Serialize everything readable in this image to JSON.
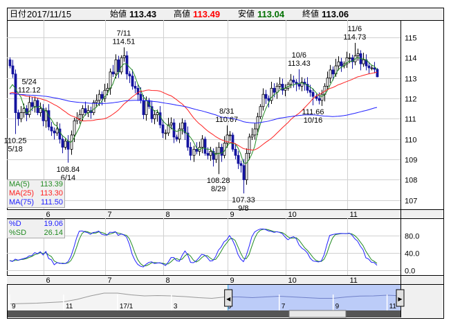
{
  "header": {
    "date_label": "日付",
    "date_value": "2017/11/15",
    "open_label": "始値",
    "open_value": "113.43",
    "high_label": "高値",
    "high_value": "113.49",
    "low_label": "安値",
    "low_value": "113.04",
    "close_label": "終値",
    "close_value": "113.06"
  },
  "colors": {
    "up": "#ffffff",
    "down": "#1414a0",
    "ma5": "#228b22",
    "ma25": "#ff2020",
    "ma75": "#2020ff",
    "d": "#2020ff",
    "sd": "#228b22",
    "high_text": "#ff0000",
    "low_text": "#007000",
    "nav_fill": "#bcccf8"
  },
  "ma_legend": [
    {
      "label": "MA(5)",
      "value": "113.39"
    },
    {
      "label": "MA(25)",
      "value": "113.30"
    },
    {
      "label": "MA(75)",
      "value": "111.50"
    }
  ],
  "stoch_legend": [
    {
      "label": "%D",
      "value": "19.06"
    },
    {
      "label": "%SD",
      "value": "26.14"
    }
  ],
  "chart_data": {
    "type": "candlestick",
    "price": {
      "ylim": [
        106.55,
        115.85
      ],
      "y_ticks": [
        "107",
        "108",
        "109",
        "110",
        "111",
        "112",
        "113",
        "114",
        "115"
      ],
      "month_labels": [
        {
          "label": "6",
          "start_index": 13
        },
        {
          "label": "7",
          "start_index": 35
        },
        {
          "label": "8",
          "start_index": 56
        },
        {
          "label": "9",
          "start_index": 79
        },
        {
          "label": "10",
          "start_index": 100
        },
        {
          "label": "11",
          "start_index": 122
        }
      ],
      "first_open": 113.9,
      "closes": [
        113.6,
        113.2,
        111.3,
        111.0,
        111.3,
        111.5,
        111.2,
        111.8,
        111.6,
        111.9,
        111.3,
        111.5,
        110.9,
        111.4,
        110.6,
        110.4,
        110.3,
        110.5,
        110.0,
        109.6,
        109.9,
        109.5,
        110.2,
        110.9,
        111.0,
        111.2,
        111.5,
        111.3,
        111.4,
        111.3,
        111.8,
        111.9,
        112.2,
        112.0,
        112.4,
        112.5,
        113.3,
        113.2,
        113.9,
        113.3,
        114.0,
        114.1,
        113.2,
        113.1,
        112.6,
        112.5,
        112.2,
        111.9,
        111.2,
        111.9,
        111.6,
        111.0,
        111.2,
        111.3,
        110.7,
        110.3,
        110.3,
        110.7,
        110.8,
        110.1,
        110.0,
        110.5,
        110.8,
        110.3,
        109.6,
        109.2,
        109.5,
        109.4,
        109.6,
        110.0,
        109.3,
        109.2,
        109.4,
        109.0,
        109.3,
        109.6,
        109.2,
        109.8,
        110.2,
        110.2,
        109.5,
        109.2,
        108.8,
        108.7,
        108.0,
        109.3,
        110.1,
        110.2,
        110.5,
        111.1,
        111.6,
        112.2,
        112.0,
        111.9,
        112.5,
        112.3,
        112.6,
        112.7,
        112.4,
        112.5,
        112.7,
        112.9,
        112.8,
        112.7,
        112.6,
        112.8,
        112.7,
        112.4,
        112.3,
        112.1,
        112.0,
        111.9,
        112.2,
        112.6,
        113.0,
        113.4,
        113.2,
        113.6,
        113.8,
        113.6,
        113.7,
        114.0,
        114.0,
        113.8,
        114.1,
        114.2,
        113.7,
        113.9,
        113.6,
        113.5,
        113.5,
        113.43,
        113.06
      ],
      "last_candle": {
        "open": 113.43,
        "high": 113.49,
        "low": 113.04,
        "close": 113.06
      },
      "annotations": [
        {
          "index": 2,
          "kind": "low",
          "value": "110.25",
          "date": "5/18",
          "price": 110.25
        },
        {
          "index": 7,
          "kind": "high",
          "value": "112.12",
          "date": "5/24",
          "price": 112.12
        },
        {
          "index": 21,
          "kind": "low",
          "value": "108.84",
          "date": "6/14",
          "price": 108.84
        },
        {
          "index": 41,
          "kind": "high",
          "value": "114.51",
          "date": "7/11",
          "price": 114.51
        },
        {
          "index": 75,
          "kind": "low",
          "value": "108.28",
          "date": "8/29",
          "price": 108.28
        },
        {
          "index": 78,
          "kind": "high",
          "value": "110.67",
          "date": "8/31",
          "price": 110.67
        },
        {
          "index": 84,
          "kind": "low",
          "value": "107.33",
          "date": "9/8",
          "price": 107.33
        },
        {
          "index": 104,
          "kind": "high",
          "value": "113.43",
          "date": "10/6",
          "price": 113.43
        },
        {
          "index": 109,
          "kind": "low",
          "value": "111.66",
          "date": "10/16",
          "price": 111.66
        },
        {
          "index": 124,
          "kind": "high",
          "value": "114.73",
          "date": "11/6",
          "price": 114.73
        }
      ],
      "series": [
        "MA(5)",
        "MA(25)",
        "MA(75)"
      ]
    },
    "stochastic": {
      "ylim": [
        0,
        100
      ],
      "y_ticks": [
        "0.0",
        "40.0",
        "80.0"
      ],
      "series": [
        "%D",
        "%SD"
      ]
    },
    "navigator": {
      "labels": [
        {
          "label": "9",
          "month": 0
        },
        {
          "label": "11",
          "month": 2
        },
        {
          "label": "17/1",
          "month": 4
        },
        {
          "label": "3",
          "month": 6
        },
        {
          "label": "5",
          "month": 8
        },
        {
          "label": "7",
          "month": 10
        },
        {
          "label": "9",
          "month": 12
        },
        {
          "label": "11",
          "month": 14
        }
      ],
      "values": [
        101.5,
        102,
        102.5,
        103.5,
        104.5,
        108,
        113,
        117,
        117,
        114.5,
        113,
        113.5,
        113,
        112,
        110.5,
        109.5,
        111.5,
        111.5,
        110.5,
        111.5,
        112.5,
        111.5,
        110.5,
        109.5,
        109.5,
        111.5,
        112.8,
        113,
        114,
        113.1
      ],
      "selected_from_month": 8.1,
      "selected_to_month": 14.5
    }
  }
}
